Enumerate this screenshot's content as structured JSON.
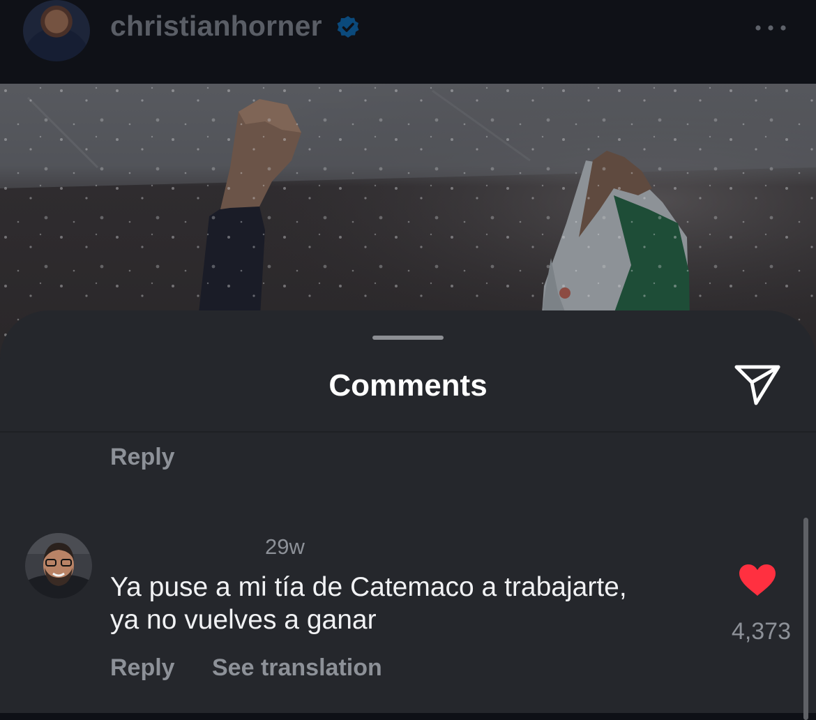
{
  "header": {
    "username": "christianhorner",
    "verified": true,
    "verified_color": "#0095f6",
    "more_icon": "more-horizontal-icon"
  },
  "post_image": {
    "subject": "raised-fist-and-mexico-flag-celebration"
  },
  "comments_sheet": {
    "title": "Comments",
    "share_icon": "send-icon",
    "previous_comment_reply_label": "Reply",
    "comment": {
      "timestamp": "29w",
      "text_line_1": "Ya puse a mi tía de Catemaco a trabajarte,",
      "text_line_2": "ya no vuelves a ganar",
      "liked": true,
      "heart_color": "#ff3040",
      "like_count": "4,373",
      "reply_label": "Reply",
      "translation_label": "See translation"
    }
  }
}
